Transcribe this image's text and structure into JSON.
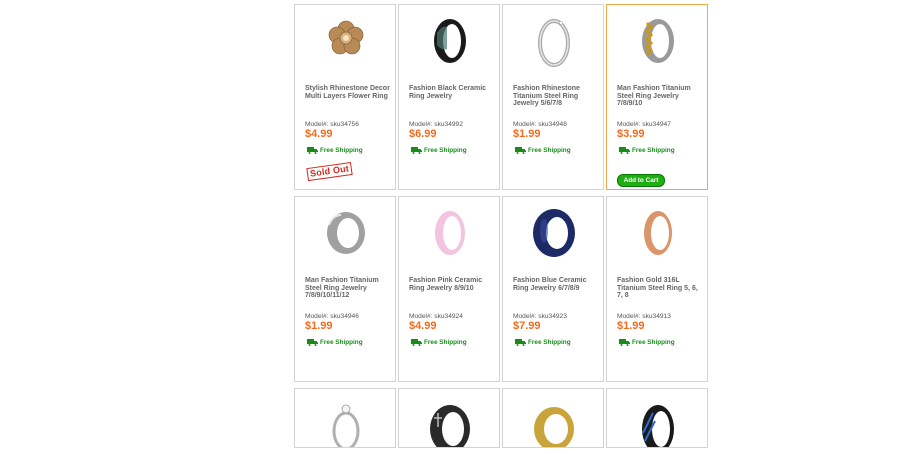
{
  "labels": {
    "free_shipping": "Free Shipping",
    "sold_out": "Sold Out",
    "add_to_cart": "Add to Cart"
  },
  "products": [
    {
      "name": "Stylish Rhinestone Decor Multi Layers Flower Ring",
      "model": "Model#: sku34756",
      "price": "$4.99"
    },
    {
      "name": "Fashion Black Ceramic Ring Jewelry",
      "model": "Model#: sku34992",
      "price": "$6.99"
    },
    {
      "name": "Fashion Rhinestone Titanium Steel Ring Jewelry 5/6/7/8",
      "model": "Model#: sku34948",
      "price": "$1.99"
    },
    {
      "name": "Man Fashion Titanium Steel Ring Jewelry 7/8/9/10",
      "model": "Model#: sku34947",
      "price": "$3.99"
    },
    {
      "name": "Man Fashion Titanium Steel Ring Jewelry 7/8/9/10/11/12",
      "model": "Model#: sku34946",
      "price": "$1.99"
    },
    {
      "name": "Fashion Pink Ceramic Ring Jewelry 8/9/10",
      "model": "Model#: sku34924",
      "price": "$4.99"
    },
    {
      "name": "Fashion Blue Ceramic Ring Jewelry 6/7/8/9",
      "model": "Model#: sku34923",
      "price": "$7.99"
    },
    {
      "name": "Fashion Gold 316L Titanium Steel Ring 5, 6, 7, 8",
      "model": "Model#: sku34913",
      "price": "$1.99"
    }
  ],
  "colors": {
    "price": "#f06d1e",
    "shipping": "#1a8c1a",
    "highlight_border": "#f0a84a",
    "cart_button": "#1fae14"
  },
  "icons": {
    "shipping": "truck-icon"
  }
}
